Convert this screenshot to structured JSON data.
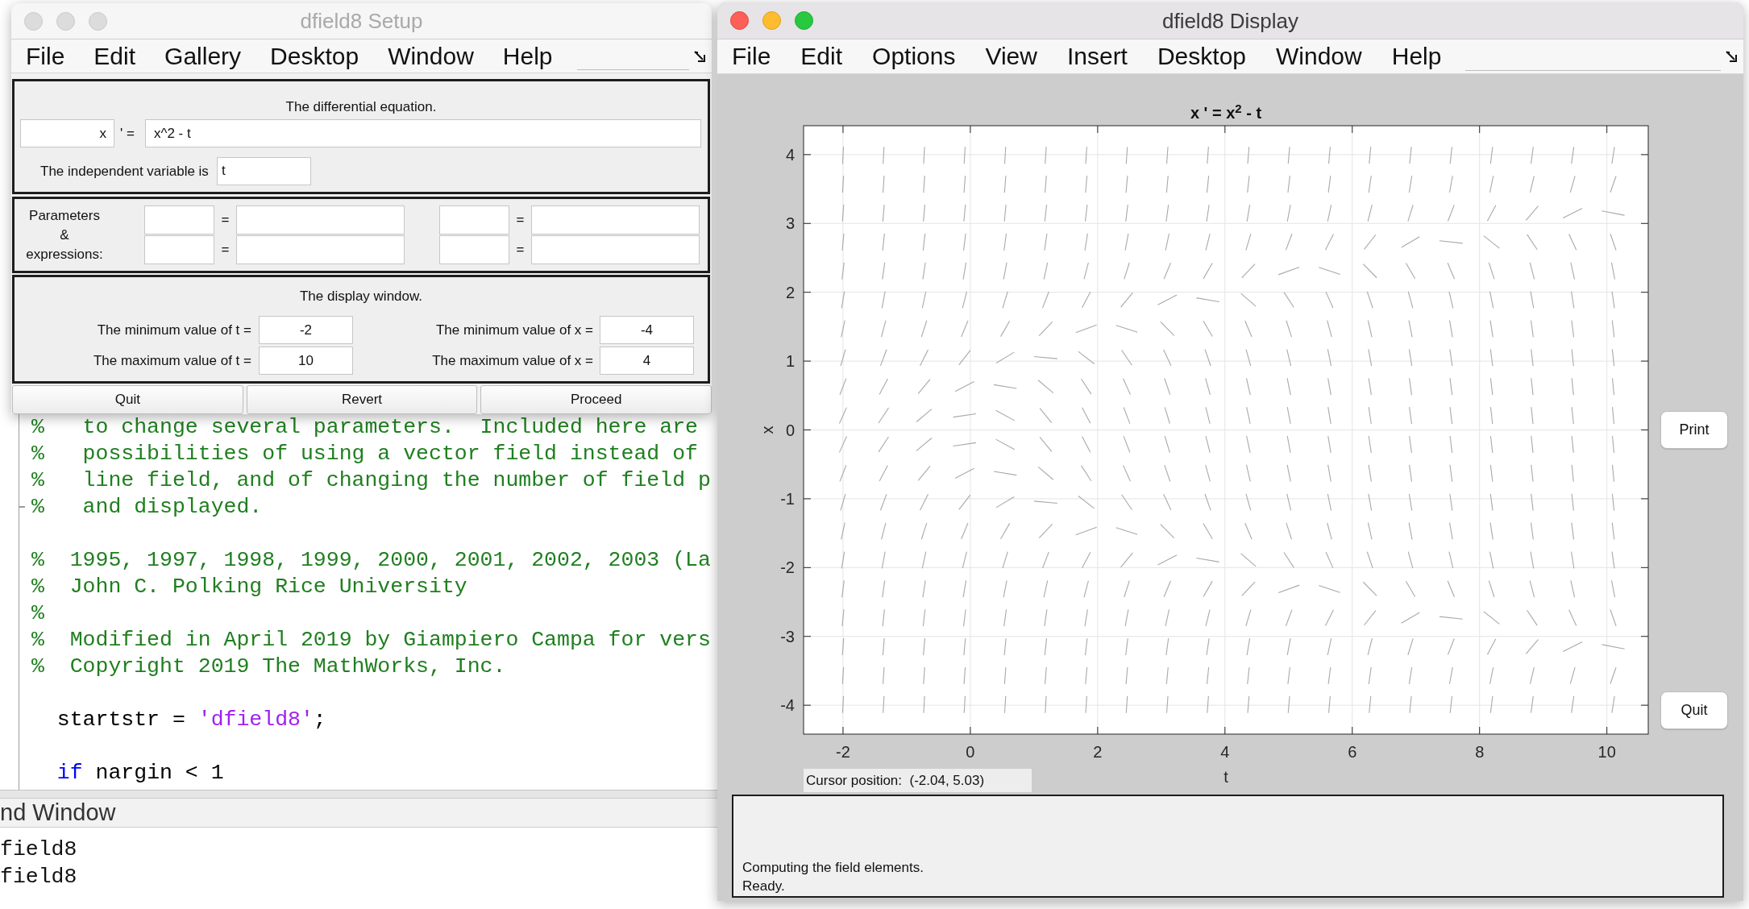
{
  "setup_window": {
    "title": "dfield8 Setup",
    "active": false,
    "menu": [
      "File",
      "Edit",
      "Gallery",
      "Desktop",
      "Window",
      "Help"
    ],
    "equation_panel": {
      "heading": "The differential equation.",
      "dependent_variable": "x",
      "derivative_sign": "' =",
      "equation": "x^2 - t",
      "independent_label": "The independent variable is",
      "independent_variable": "t"
    },
    "parameters_panel": {
      "label_lines": [
        "Parameters",
        "&",
        "expressions:"
      ],
      "pairs": [
        {
          "sign": "="
        },
        {
          "sign": "="
        },
        {
          "sign": "="
        },
        {
          "sign": "="
        }
      ]
    },
    "display_panel": {
      "heading": "The display window.",
      "limits": [
        {
          "label": "The minimum value of t =",
          "value": "-2"
        },
        {
          "label": "The minimum value of x =",
          "value": "-4"
        },
        {
          "label": "The maximum value of t =",
          "value": "10"
        },
        {
          "label": "The maximum value of x =",
          "value": "4"
        }
      ]
    },
    "buttons": [
      "Quit",
      "Revert",
      "Proceed"
    ]
  },
  "matlab_editor": {
    "blocks": [
      [
        {
          "fold_end": false,
          "tokens": [
            {
              "kind": "comment",
              "text": "%   to change several parameters.  Included here are"
            }
          ]
        },
        {
          "fold_end": false,
          "tokens": [
            {
              "kind": "comment",
              "text": "%   possibilities of using a vector field instead of"
            }
          ]
        },
        {
          "fold_end": false,
          "tokens": [
            {
              "kind": "comment",
              "text": "%   line field, and of changing the number of field p"
            }
          ]
        },
        {
          "fold_end": true,
          "tokens": [
            {
              "kind": "comment",
              "text": "%   and displayed."
            }
          ]
        }
      ],
      [
        {
          "fold_end": false,
          "tokens": [
            {
              "kind": "comment",
              "text": "%  1995, 1997, 1998, 1999, 2000, 2001, 2002, 2003 (La"
            }
          ]
        },
        {
          "fold_end": false,
          "tokens": [
            {
              "kind": "comment",
              "text": "%  John C. Polking Rice University"
            }
          ]
        },
        {
          "fold_end": false,
          "tokens": [
            {
              "kind": "comment",
              "text": "%"
            }
          ]
        },
        {
          "fold_end": false,
          "tokens": [
            {
              "kind": "comment",
              "text": "%  Modified in April 2019 by Giampiero Campa for vers"
            }
          ]
        },
        {
          "fold_end": false,
          "tokens": [
            {
              "kind": "comment",
              "text": "%  Copyright 2019 The MathWorks, Inc."
            }
          ]
        }
      ],
      [
        {
          "fold_end": false,
          "tokens": [
            {
              "kind": "code",
              "text": "  startstr = "
            },
            {
              "kind": "string",
              "text": "'dfield8'"
            },
            {
              "kind": "code",
              "text": ";"
            }
          ]
        }
      ],
      [
        {
          "fold_end": false,
          "tokens": [
            {
              "kind": "keyword",
              "text": "  if"
            },
            {
              "kind": "code",
              "text": " nargin < 1"
            }
          ]
        }
      ]
    ]
  },
  "command_window": {
    "title": "nd Window",
    "lines": [
      "field8",
      "field8"
    ]
  },
  "display_window": {
    "title": "dfield8 Display",
    "active": true,
    "menu": [
      "File",
      "Edit",
      "Options",
      "View",
      "Insert",
      "Desktop",
      "Window",
      "Help"
    ],
    "plot": {
      "title": "x ' = x$^{2}$ - t",
      "ylabel": "x",
      "yticks": [
        "4",
        "3",
        "2",
        "1",
        "0",
        "-1",
        "-2",
        "-3",
        "-4"
      ],
      "xticks": [
        "-2",
        "0",
        "2",
        "4",
        "6",
        "8",
        "10"
      ],
      "xlabel": "t"
    },
    "cursor_position": "Cursor position:  (-2.04, 5.03)",
    "buttons": [
      "Print",
      "Quit"
    ],
    "messages": [
      "Computing the field elements.",
      "Ready."
    ]
  }
}
